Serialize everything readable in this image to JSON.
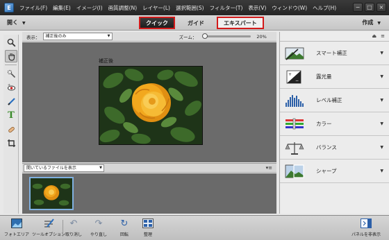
{
  "menubar": {
    "logo": "E",
    "items": [
      "ファイル(F)",
      "編集(E)",
      "イメージ(I)",
      "画質調整(N)",
      "レイヤー(L)",
      "選択範囲(S)",
      "フィルター(T)",
      "表示(V)",
      "ウィンドウ(W)",
      "ヘルプ(H)"
    ],
    "window_controls": [
      "−",
      "□",
      "×"
    ]
  },
  "modebar": {
    "open_label": "開く",
    "tabs": [
      {
        "label": "クイック",
        "state": "active"
      },
      {
        "label": "ガイド",
        "state": "normal"
      },
      {
        "label": "エキスパート",
        "state": "highlighted"
      }
    ],
    "create_label": "作成",
    "accent_color": "#d31a1a"
  },
  "toolbar": {
    "tools": [
      "zoom-icon",
      "hand-icon",
      "quick-selection-icon",
      "red-eye-icon",
      "whiten-teeth-icon",
      "text-icon",
      "spot-healing-icon",
      "crop-icon"
    ]
  },
  "document": {
    "view_label": "表示：",
    "view_value": "補正後のみ",
    "zoom_label": "ズーム：",
    "zoom_value": "20%",
    "zoom_level": 0.0,
    "after_label": "補正後"
  },
  "bin": {
    "select_value": "開いているファイルを表示"
  },
  "panel": {
    "items": [
      {
        "label": "スマート補正",
        "icon": "smart-fix-icon"
      },
      {
        "label": "露光量",
        "icon": "exposure-icon"
      },
      {
        "label": "レベル補正",
        "icon": "levels-icon"
      },
      {
        "label": "カラー",
        "icon": "color-icon"
      },
      {
        "label": "バランス",
        "icon": "balance-icon"
      },
      {
        "label": "シャープ",
        "icon": "sharpen-icon"
      }
    ]
  },
  "bottombar": {
    "photo_bin": "フォトエリア",
    "tool_options": "ツールオプション",
    "undo": "取り消し",
    "redo": "やり直し",
    "rotate": "回転",
    "organizer": "整理",
    "hide_panel": "パネルを非表示"
  }
}
